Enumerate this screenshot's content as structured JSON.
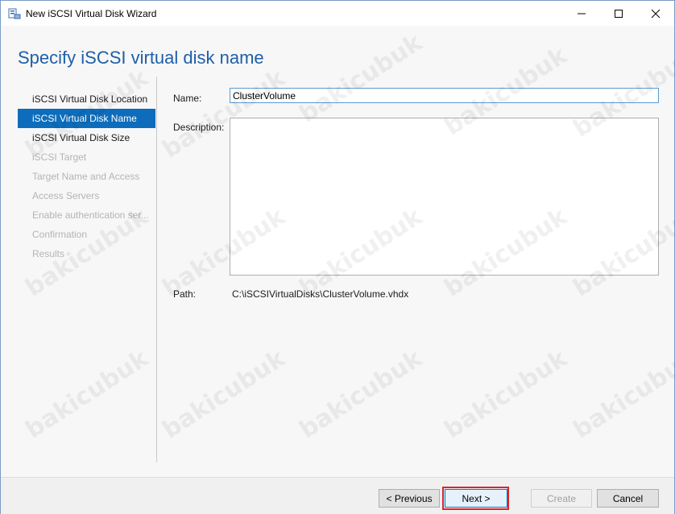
{
  "window": {
    "title": "New iSCSI Virtual Disk Wizard"
  },
  "page": {
    "title": "Specify iSCSI virtual disk name"
  },
  "nav": {
    "items": [
      {
        "label": "iSCSI Virtual Disk Location",
        "state": "normal"
      },
      {
        "label": "iSCSI Virtual Disk Name",
        "state": "active"
      },
      {
        "label": "iSCSI Virtual Disk Size",
        "state": "normal"
      },
      {
        "label": "iSCSI Target",
        "state": "disabled"
      },
      {
        "label": "Target Name and Access",
        "state": "disabled"
      },
      {
        "label": "Access Servers",
        "state": "disabled"
      },
      {
        "label": "Enable authentication ser...",
        "state": "disabled"
      },
      {
        "label": "Confirmation",
        "state": "disabled"
      },
      {
        "label": "Results",
        "state": "disabled"
      }
    ]
  },
  "form": {
    "name_label": "Name:",
    "name_value": "ClusterVolume",
    "description_label": "Description:",
    "description_value": "",
    "path_label": "Path:",
    "path_value": "C:\\iSCSIVirtualDisks\\ClusterVolume.vhdx"
  },
  "footer": {
    "previous_label": "< Previous",
    "next_label": "Next >",
    "create_label": "Create",
    "cancel_label": "Cancel"
  },
  "watermark": {
    "text": "bakicubuk"
  },
  "colors": {
    "accent": "#0d6dbc",
    "title": "#1e5fa8",
    "highlight": "#d7262c"
  }
}
